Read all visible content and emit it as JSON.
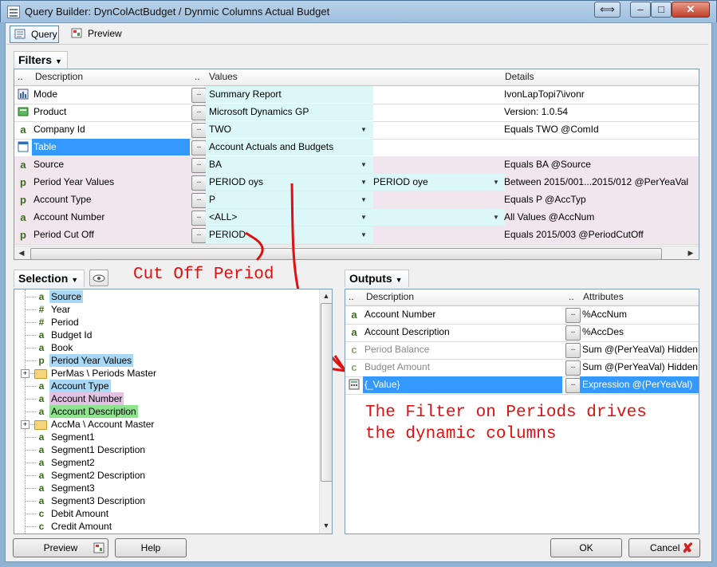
{
  "window": {
    "title": "Query Builder: DynColActBudget / Dynmic Columns Actual Budget",
    "resize_glyph": "⟺",
    "minimize_glyph": "–",
    "maximize_glyph": "□",
    "close_glyph": "✕"
  },
  "tabs": [
    {
      "label": "Query",
      "active": true
    },
    {
      "label": "Preview",
      "active": false
    }
  ],
  "filters": {
    "header": "Filters",
    "columns": {
      "dots1": "..",
      "description": "Description",
      "dots2": "..",
      "values": "Values",
      "details": "Details"
    },
    "rows": [
      {
        "icon": "summary-icon",
        "description": "Mode",
        "value": "Summary Report",
        "value2": "",
        "details": "IvonLapTopi7\\ivonr",
        "dropdown": false,
        "dropdown2": false
      },
      {
        "icon": "product-icon",
        "description": "Product",
        "value": "Microsoft Dynamics GP",
        "value2": "",
        "details": "Version: 1.0.54",
        "dropdown": false,
        "dropdown2": false
      },
      {
        "icon": "text-a-icon",
        "description": "Company Id",
        "value": "TWO",
        "value2": "",
        "details": "Equals TWO @ComId",
        "dropdown": true,
        "dropdown2": false
      },
      {
        "icon": "table-icon",
        "description": "Table",
        "value": "Account Actuals and Budgets",
        "value2": "",
        "details": "",
        "dropdown": false,
        "dropdown2": false,
        "selected": true
      },
      {
        "icon": "text-a-icon",
        "description": "Source",
        "value": "BA",
        "value2": "",
        "details": "Equals BA @Source",
        "dropdown": true,
        "dropdown2": false
      },
      {
        "icon": "period-p-icon",
        "description": "Period Year Values",
        "value": "PERIOD oys",
        "value2": "PERIOD oye",
        "details": "Between 2015/001...2015/012 @PerYeaVal",
        "dropdown": true,
        "dropdown2": true
      },
      {
        "icon": "period-p-icon",
        "description": "Account Type",
        "value": "P",
        "value2": "",
        "details": "Equals P @AccTyp",
        "dropdown": true,
        "dropdown2": false
      },
      {
        "icon": "text-a-icon",
        "description": "Account Number",
        "value": "<ALL>",
        "value2": "",
        "details": "All Values @AccNum",
        "dropdown": true,
        "dropdown2": true
      },
      {
        "icon": "period-p-icon",
        "description": "Period Cut Off",
        "value": "PERIOD",
        "value2": "",
        "details": "Equals 2015/003 @PeriodCutOff",
        "dropdown": true,
        "dropdown2": false
      }
    ]
  },
  "annotations": {
    "cut_off": "Cut Off Period",
    "filter_note_line1": "The Filter on Periods drives",
    "filter_note_line2": "the dynamic columns",
    "color": "#e01010"
  },
  "selection": {
    "header": "Selection",
    "items": [
      {
        "icon": "a",
        "label": "Source",
        "highlight": "#a8d8f4",
        "folder": false
      },
      {
        "icon": "#",
        "label": "Year",
        "highlight": "",
        "folder": false
      },
      {
        "icon": "#",
        "label": "Period",
        "highlight": "",
        "folder": false
      },
      {
        "icon": "a",
        "label": "Budget Id",
        "highlight": "",
        "folder": false
      },
      {
        "icon": "a",
        "label": "Book",
        "highlight": "",
        "folder": false
      },
      {
        "icon": "p",
        "label": "Period Year Values",
        "highlight": "#a8d8f4",
        "folder": false
      },
      {
        "icon": "",
        "label": "PerMas \\ Periods Master",
        "highlight": "",
        "folder": true
      },
      {
        "icon": "a",
        "label": "Account Type",
        "highlight": "#a8d8f4",
        "folder": false
      },
      {
        "icon": "a",
        "label": "Account Number",
        "highlight": "#e3c3e3",
        "folder": false
      },
      {
        "icon": "a",
        "label": "Account Description",
        "highlight": "#8ee38e",
        "folder": false
      },
      {
        "icon": "",
        "label": "AccMa \\ Account Master",
        "highlight": "",
        "folder": true
      },
      {
        "icon": "a",
        "label": "Segment1",
        "highlight": "",
        "folder": false
      },
      {
        "icon": "a",
        "label": "Segment1 Description",
        "highlight": "",
        "folder": false
      },
      {
        "icon": "a",
        "label": "Segment2",
        "highlight": "",
        "folder": false
      },
      {
        "icon": "a",
        "label": "Segment2 Description",
        "highlight": "",
        "folder": false
      },
      {
        "icon": "a",
        "label": "Segment3",
        "highlight": "",
        "folder": false
      },
      {
        "icon": "a",
        "label": "Segment3 Description",
        "highlight": "",
        "folder": false
      },
      {
        "icon": "c",
        "label": "Debit Amount",
        "highlight": "",
        "folder": false
      },
      {
        "icon": "c",
        "label": "Credit Amount",
        "highlight": "",
        "folder": false
      }
    ]
  },
  "outputs": {
    "header": "Outputs",
    "columns": {
      "dots1": "..",
      "description": "Description",
      "dots2": "..",
      "attributes": "Attributes"
    },
    "rows": [
      {
        "icon": "a",
        "description": "Account Number",
        "attributes": "%AccNum",
        "style": "normal"
      },
      {
        "icon": "a",
        "description": "Account Description",
        "attributes": "%AccDes",
        "style": "normal"
      },
      {
        "icon": "c",
        "description": "Period Balance",
        "attributes": "Sum @(PerYeaVal) Hidden %P",
        "style": "gray"
      },
      {
        "icon": "c",
        "description": "Budget Amount",
        "attributes": "Sum @(PerYeaVal) Hidden %B",
        "style": "gray"
      },
      {
        "icon": "calc",
        "description": "{_Value}",
        "attributes": "Expression @(PerYeaVal)",
        "style": "selected"
      }
    ]
  },
  "buttons": {
    "preview": "Preview",
    "help": "Help",
    "ok": "OK",
    "cancel": "Cancel"
  },
  "colors": {
    "value_cell": "#dcf7f7",
    "pink_row": "#f2e6ee",
    "selection_blue": "#3399ff"
  }
}
